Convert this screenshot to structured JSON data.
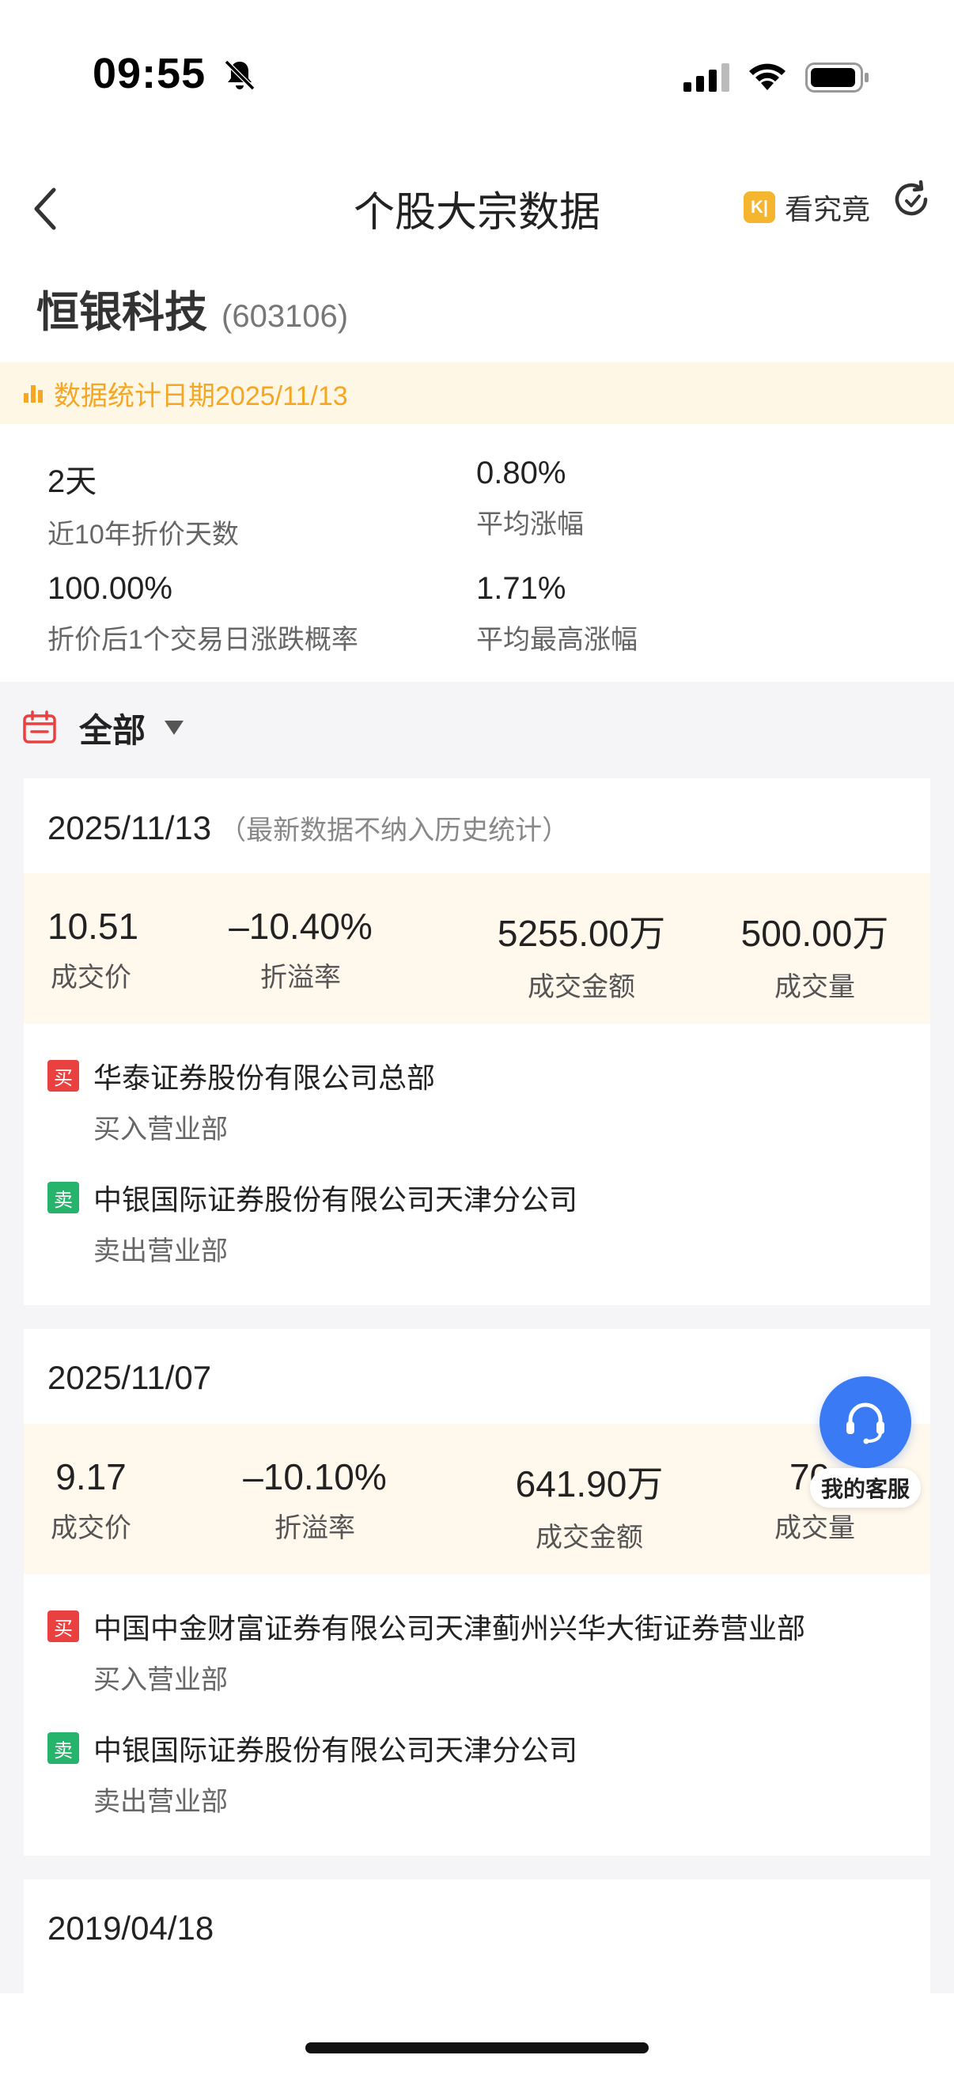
{
  "status_bar": {
    "time": "09:55"
  },
  "header": {
    "title": "个股大宗数据",
    "kjj_label": "看究竟",
    "kjj_logo": "K|"
  },
  "stock": {
    "name": "恒银科技",
    "code": "(603106)"
  },
  "stat_date": "数据统计日期2025/11/13",
  "summary": [
    {
      "value": "2天",
      "label": "近10年折价天数"
    },
    {
      "value": "0.80%",
      "label": "平均涨幅"
    },
    {
      "value": "100.00%",
      "label": "折价后1个交易日涨跌概率"
    },
    {
      "value": "1.71%",
      "label": "平均最高涨幅"
    }
  ],
  "filter": {
    "label": "全部"
  },
  "tags": {
    "buy": "买",
    "sell": "卖"
  },
  "records": [
    {
      "date": "2025/11/13",
      "note": "（最新数据不纳入历史统计）",
      "price": "10.51",
      "price_label": "成交价",
      "premium": "–10.40%",
      "premium_label": "折溢率",
      "amount": "5255.00万",
      "amount_label": "成交金额",
      "volume": "500.00万",
      "volume_label": "成交量",
      "buyer": "华泰证券股份有限公司总部",
      "buyer_role": "买入营业部",
      "seller": "中银国际证券股份有限公司天津分公司",
      "seller_role": "卖出营业部"
    },
    {
      "date": "2025/11/07",
      "price": "9.17",
      "price_label": "成交价",
      "premium": "–10.10%",
      "premium_label": "折溢率",
      "amount": "641.90万",
      "amount_label": "成交金额",
      "volume": "70.",
      "volume_label": "成交量",
      "buyer": "中国中金财富证券有限公司天津蓟州兴华大街证券营业部",
      "buyer_role": "买入营业部",
      "seller": "中银国际证券股份有限公司天津分公司",
      "seller_role": "卖出营业部"
    },
    {
      "date": "2019/04/18"
    }
  ],
  "service": {
    "label": "我的客服"
  }
}
